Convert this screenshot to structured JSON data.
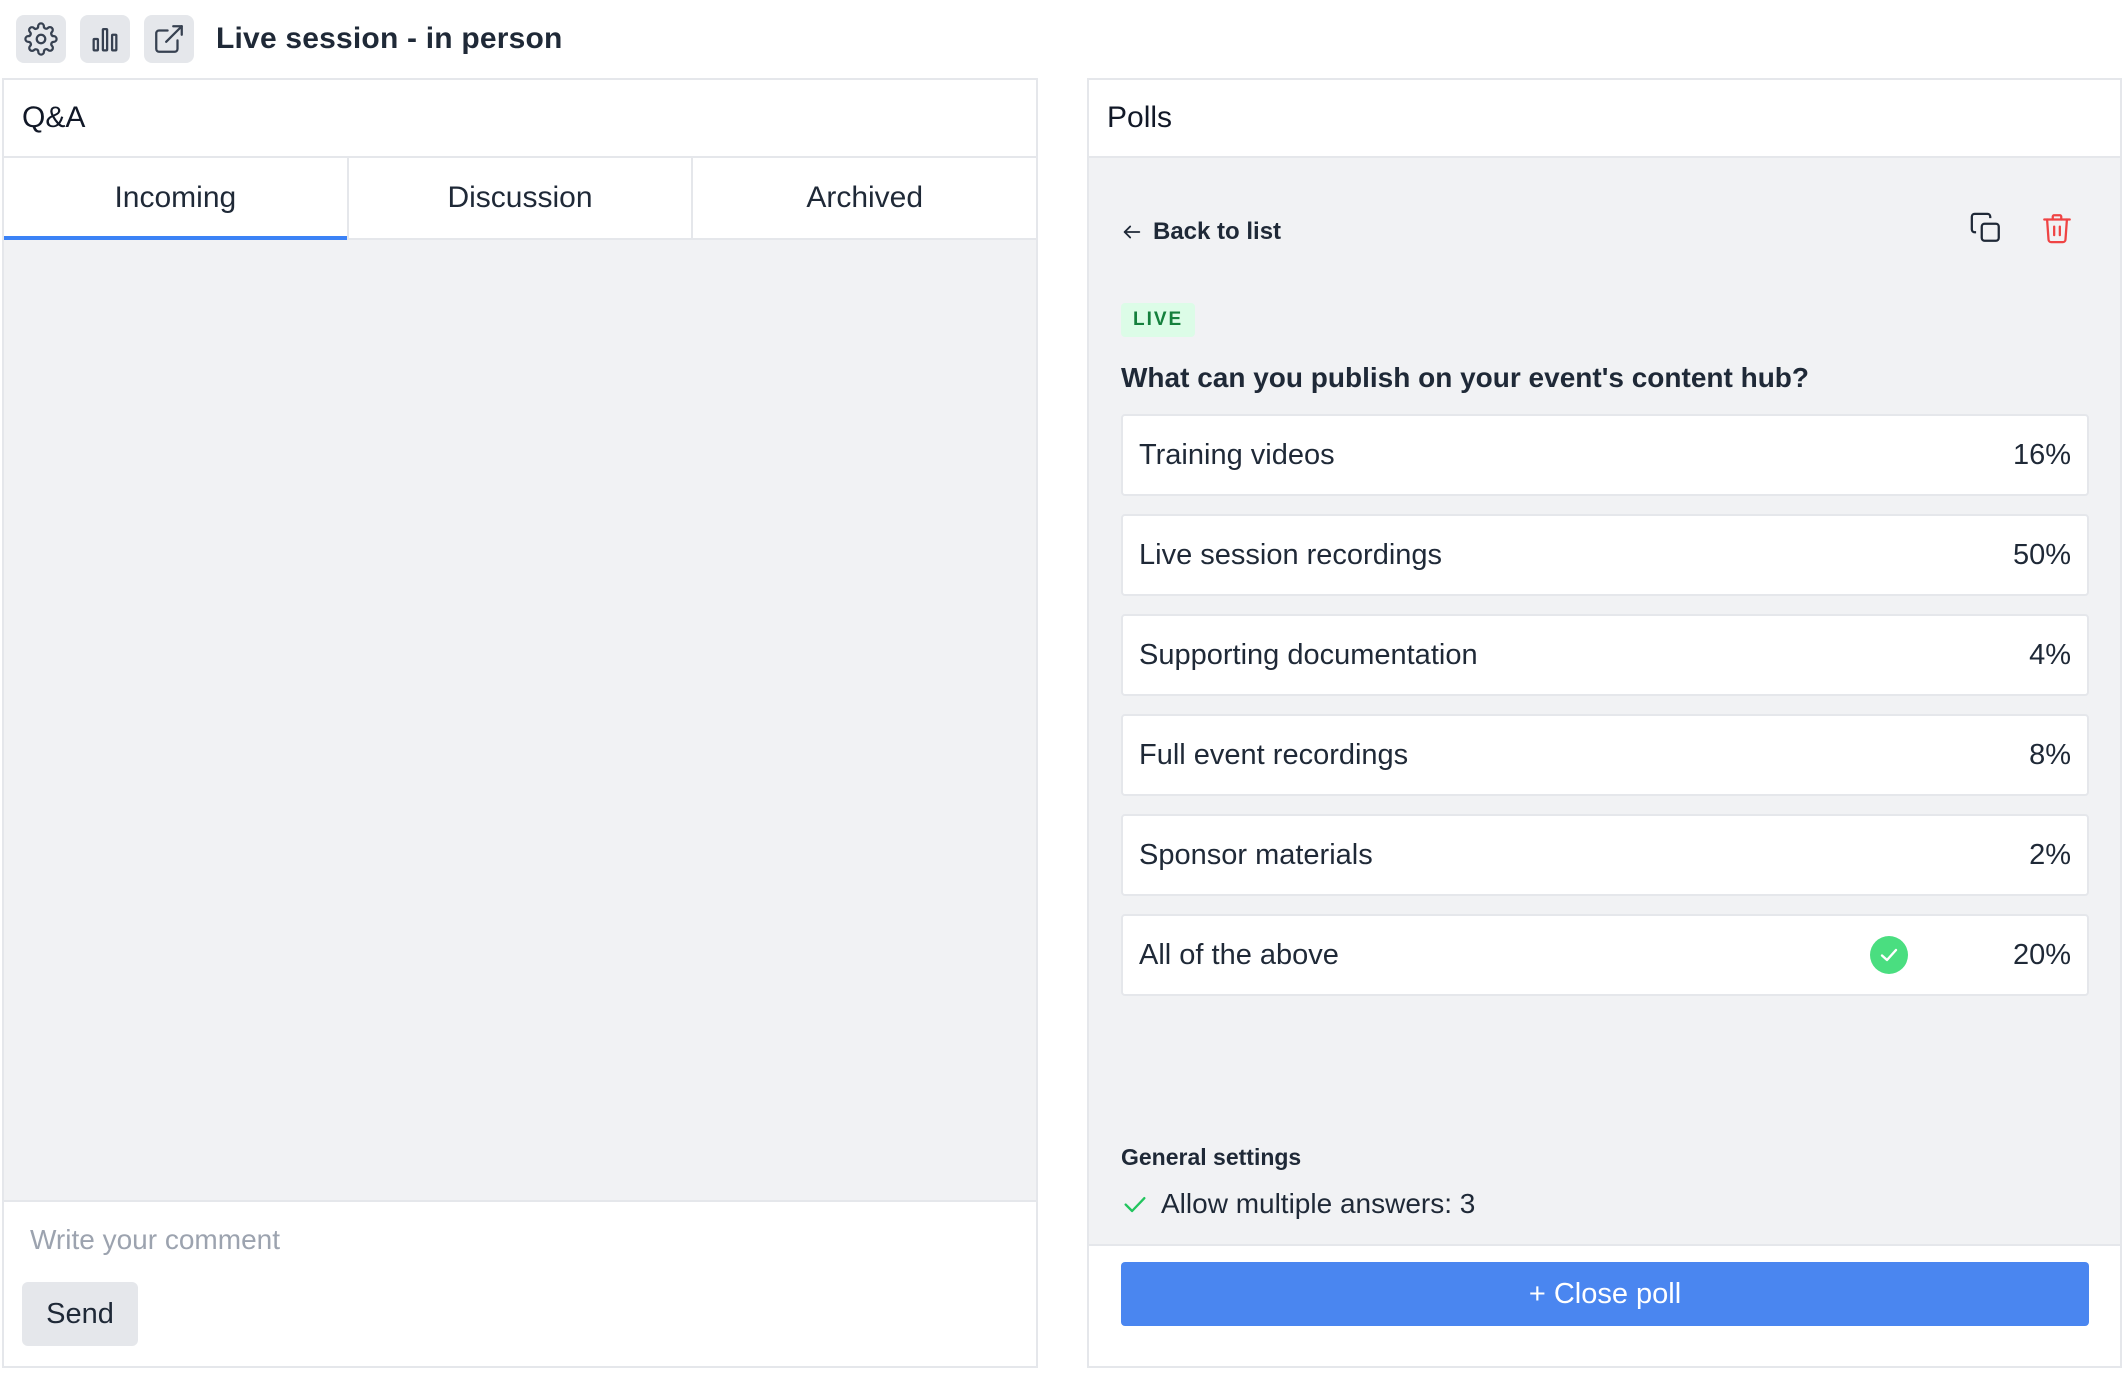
{
  "header": {
    "title": "Live session - in person",
    "buttons": [
      "gear-icon",
      "bar-chart-icon",
      "external-link-icon"
    ]
  },
  "qa": {
    "title": "Q&A",
    "tabs": [
      {
        "label": "Incoming",
        "active": true
      },
      {
        "label": "Discussion",
        "active": false
      },
      {
        "label": "Archived",
        "active": false
      }
    ],
    "comment_placeholder": "Write your comment",
    "send_label": "Send"
  },
  "polls": {
    "title": "Polls",
    "back_label": "Back to list",
    "status_badge": "LIVE",
    "question": "What can you publish on your event's content hub?",
    "options": [
      {
        "label": "Training videos",
        "percent": "16%",
        "correct": false
      },
      {
        "label": "Live session recordings",
        "percent": "50%",
        "correct": false
      },
      {
        "label": "Supporting documentation",
        "percent": "4%",
        "correct": false
      },
      {
        "label": "Full event recordings",
        "percent": "8%",
        "correct": false
      },
      {
        "label": "Sponsor materials",
        "percent": "2%",
        "correct": false
      },
      {
        "label": "All of the above",
        "percent": "20%",
        "correct": true
      }
    ],
    "settings_title": "General settings",
    "settings_items": [
      "Allow multiple answers: 3"
    ],
    "close_label": "+ Close poll"
  },
  "colors": {
    "accent": "#3b82f6",
    "button_primary": "#4a86f0",
    "live_green": "#15803d",
    "delete_red": "#ef4444",
    "check_green": "#4ade80"
  }
}
